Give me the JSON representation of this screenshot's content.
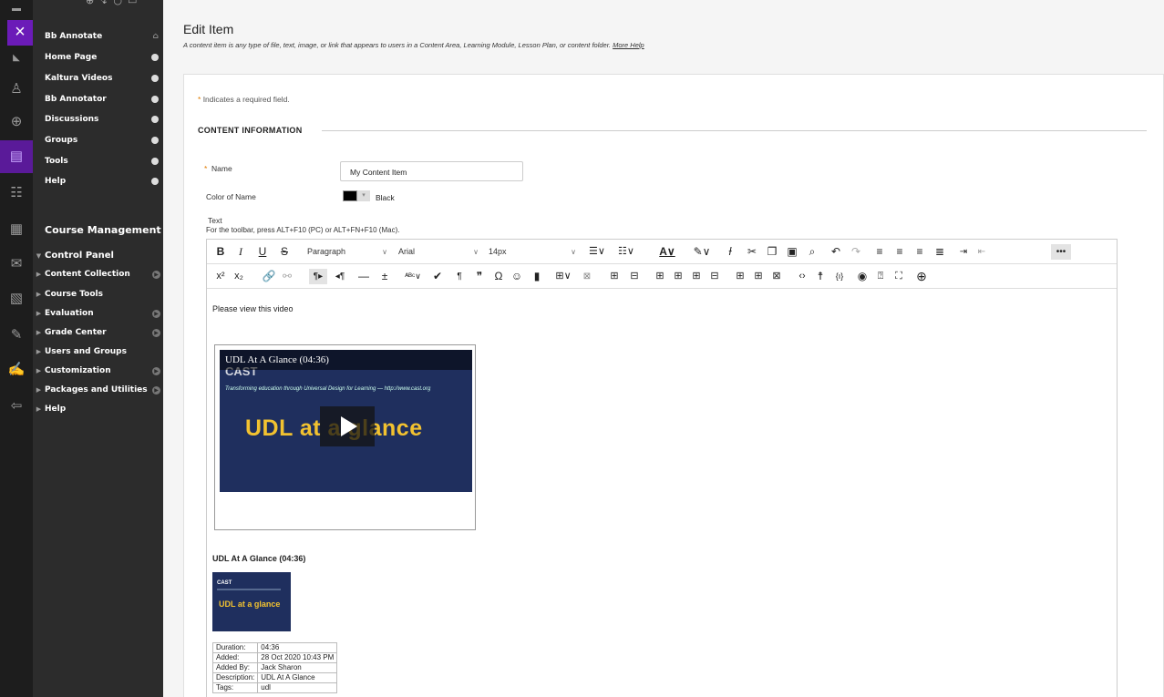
{
  "course_menu": {
    "items": [
      {
        "label": "Bb Annotate"
      },
      {
        "label": "Home Page"
      },
      {
        "label": "Kaltura Videos"
      },
      {
        "label": "Bb Annotator"
      },
      {
        "label": "Discussions"
      },
      {
        "label": "Groups"
      },
      {
        "label": "Tools"
      },
      {
        "label": "Help"
      }
    ],
    "management_title": "Course Management",
    "control_panel": [
      {
        "label": "Control Panel"
      },
      {
        "label": "Content Collection"
      },
      {
        "label": "Course Tools"
      },
      {
        "label": "Evaluation"
      },
      {
        "label": "Grade Center"
      },
      {
        "label": "Users and Groups"
      },
      {
        "label": "Customization"
      },
      {
        "label": "Packages and Utilities"
      },
      {
        "label": "Help"
      }
    ]
  },
  "page": {
    "title": "Edit Item",
    "description": "A content item is any type of file, text, image, or link that appears to users in a Content Area, Learning Module, Lesson Plan, or content folder.",
    "more_help": "More Help"
  },
  "form": {
    "required_star": "*",
    "required_note": "Indicates a required field.",
    "section_title": "CONTENT INFORMATION",
    "name_label": "Name",
    "name_value": "My Content Item",
    "color_label": "Color of Name",
    "color_value": "Black",
    "text_label": "Text",
    "toolbar_hint": "For the toolbar, press ALT+F10 (PC) or ALT+FN+F10 (Mac)."
  },
  "editor": {
    "format_value": "Paragraph",
    "font_value": "Arial",
    "size_value": "14px",
    "intro_text": "Please view this video",
    "video_title": "UDL At A Glance (04:36)",
    "video_brand": "CAST",
    "video_tagline": "Transforming education through Universal Design for Learning — http://www.cast.org",
    "video_big": "UDL at a glance",
    "caption": "UDL At A Glance (04:36)",
    "thumb_brand": "CAST",
    "thumb_big": "UDL at a glance",
    "meta": [
      {
        "k": "Duration:",
        "v": "04:36"
      },
      {
        "k": "Added:",
        "v": "28 Oct 2020 10:43 PM"
      },
      {
        "k": "Added By:",
        "v": "Jack Sharon"
      },
      {
        "k": "Description:",
        "v": "UDL At A Glance"
      },
      {
        "k": "Tags:",
        "v": "udl"
      }
    ]
  },
  "colors": {
    "brand_purple": "#6b1bb8",
    "menu_bg": "#2c2c2c",
    "required_orange": "#e07b00",
    "video_yellow": "#f2c230"
  }
}
